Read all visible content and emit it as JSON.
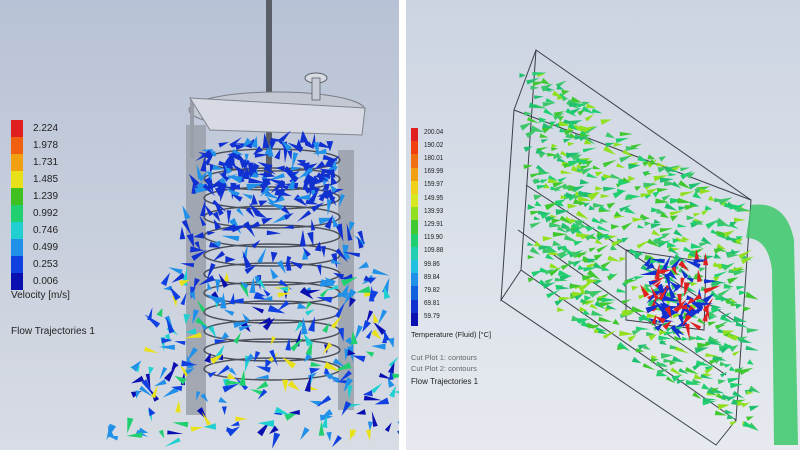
{
  "left": {
    "legend": {
      "title": "Velocity [m/s]",
      "ticks": [
        "2.224",
        "1.978",
        "1.731",
        "1.485",
        "1.239",
        "0.992",
        "0.746",
        "0.499",
        "0.253",
        "0.006"
      ],
      "colors": [
        "#e02020",
        "#f06010",
        "#f0a010",
        "#e8e018",
        "#40c020",
        "#20d070",
        "#20d0d0",
        "#2090e8",
        "#1040e0",
        "#0a10b0"
      ]
    },
    "caption": "Flow Trajectories 1"
  },
  "right": {
    "legend": {
      "title": "Temperature (Fluid) [°C]",
      "ticks": [
        "200.04",
        "190.02",
        "180.01",
        "169.99",
        "159.97",
        "149.95",
        "139.93",
        "129.91",
        "119.90",
        "109.88",
        "99.86",
        "89.84",
        "79.82",
        "69.81",
        "59.79"
      ],
      "colors": [
        "#e02020",
        "#f04010",
        "#f07010",
        "#f0a010",
        "#f0d018",
        "#d8e820",
        "#90e020",
        "#40c830",
        "#20d070",
        "#20d0b0",
        "#20c0e0",
        "#2090e8",
        "#1060e0",
        "#1030d0",
        "#0a10b0"
      ]
    },
    "captions": [
      "Cut Plot 1: contours",
      "Cut Plot 2: contours",
      "Flow Trajectories 1"
    ]
  }
}
